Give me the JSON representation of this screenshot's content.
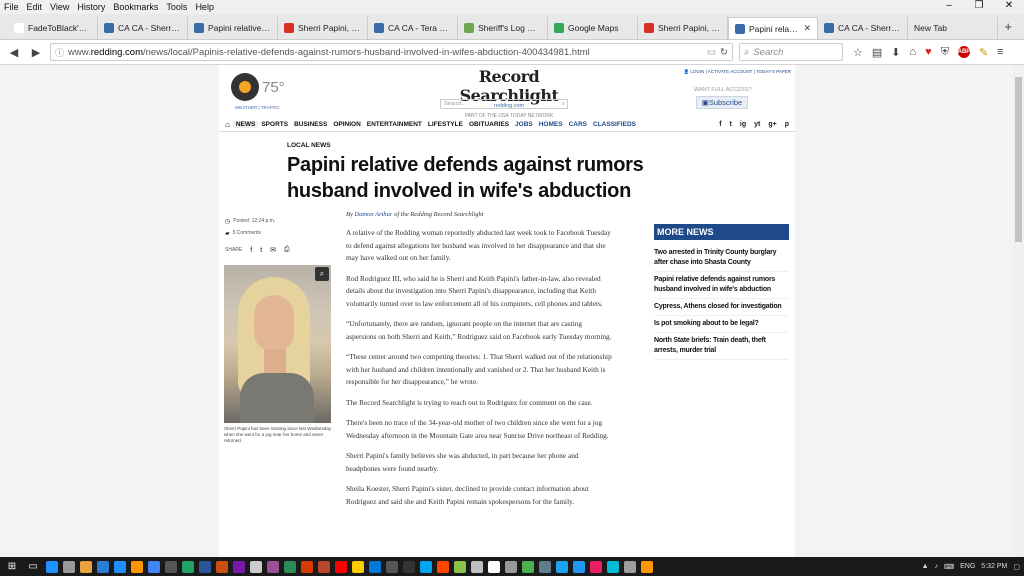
{
  "menu": [
    "File",
    "Edit",
    "View",
    "History",
    "Bookmarks",
    "Tools",
    "Help"
  ],
  "window_controls": [
    "–",
    "❐",
    "✕"
  ],
  "tabs": [
    {
      "label": "FadeToBlack's podc...",
      "color": "#ffffff"
    },
    {
      "label": "CA CA - Sherri ...",
      "color": "#3a6ba8"
    },
    {
      "label": "Papini relative d...",
      "color": "#3a6ba8"
    },
    {
      "label": "Sherri Papini, 3...",
      "color": "#d93025"
    },
    {
      "label": "CA CA - Tera S...",
      "color": "#3a6ba8"
    },
    {
      "label": "Sheriff's Log No...",
      "color": "#6ba84f"
    },
    {
      "label": "Google Maps",
      "color": "#34a853"
    },
    {
      "label": "Sherri Papini, 3...",
      "color": "#d93025"
    },
    {
      "label": "Papini relati...",
      "color": "#3a6ba8",
      "active": true
    },
    {
      "label": "CA CA - Sherri ...",
      "color": "#3a6ba8"
    },
    {
      "label": "New Tab",
      "color": ""
    }
  ],
  "address": {
    "prefix": "www.",
    "domain": "redding.com",
    "path": "/news/local/Papinis-relative-defends-against-rumors-husband-involved-in-wifes-abduction-400434981.html"
  },
  "search_placeholder": "Search",
  "site": {
    "temperature": "75°",
    "weather_links": "WEATHER | TRAFFIC",
    "logo": "Record Searchlight",
    "logo_domain": "redding.com",
    "network": "PART OF THE USA TODAY NETWORK",
    "search_placeholder": "Search...",
    "account_links": "LOGIN | ACTIVATE ACCOUNT | TODAY'S PAPER",
    "want_access": "WANT FULL ACCESS?",
    "subscribe": "Subscribe",
    "nav": [
      {
        "label": "NEWS",
        "active": true
      },
      {
        "label": "SPORTS"
      },
      {
        "label": "BUSINESS"
      },
      {
        "label": "OPINION"
      },
      {
        "label": "ENTERTAINMENT"
      },
      {
        "label": "LIFESTYLE"
      },
      {
        "label": "OBITUARIES"
      },
      {
        "label": "JOBS",
        "blue": true
      },
      {
        "label": "HOMES",
        "blue": true
      },
      {
        "label": "CARS",
        "blue": true
      },
      {
        "label": "CLASSIFIEDS",
        "blue": true
      }
    ],
    "social": [
      "f",
      "t",
      "ig",
      "yt",
      "g+",
      "p"
    ]
  },
  "article": {
    "kicker": "LOCAL NEWS",
    "headline": "Papini relative defends against rumors husband involved in wife's abduction",
    "posted": "Posted: 12:24 p.m.",
    "comments": "5 Comments",
    "share_label": "SHARE",
    "byline_prefix": "By",
    "author": "Damon Arthur",
    "byline_suffix": "of the Redding Record Searchlight",
    "photo_caption": "Sherri Papini has been missing since last Wednesday when she went for a jog near her home and never returned.",
    "paragraphs": [
      "A relative of the Redding woman reportedly abducted last week took to Facebook Tuesday to defend against allegations her husband was involved in her disappearance and that she may have walked out on her family.",
      "Rod Rodriguez III, who said he is Sherri and Keith Papini's father-in-law, also revealed details about the investigation into Sherri Papini's disappearance, including that Keith voluntarily turned over to law enforcement all of his computers, cell phones and tablets.",
      "“Unfortunately, there are random, ignorant people on the internet that are casting aspersions on both Sherri and Keith,” Rodriguez said on Facebook early Tuesday morning.",
      "“These center around two competing theories: 1. That Sherri walked out of the relationship with her husband and children intentionally and vanished or 2. That her husband Keith is responsible for her disappearance,” he wrote.",
      "The Record Searchlight is trying to reach out to Rodriguez for comment on the case.",
      "There's been no trace of the 34-year-old mother of two children since she went for a jog Wednesday afternoon in the Mountain Gate area near Sunrise Drive northeast of Redding.",
      "Sherri Papini's family believes she was abducted, in part because her phone and headphones were found nearby.",
      "Sheila Koester, Sherri Papini's sister, declined to provide contact information about Rodriguez and said she and Keith Papini remain spokespersons for the family."
    ]
  },
  "more_news": {
    "title": "MORE NEWS",
    "items": [
      "Two arrested in Trinity County burglary after chase into Shasta County",
      "Papini relative defends against rumors husband involved in wife's abduction",
      "Cypress, Athens closed for investigation",
      "Is pot smoking about to be legal?",
      "North State briefs: Train death, theft arrests, murder trial"
    ]
  },
  "taskbar": {
    "app_colors": [
      "#1e90ff",
      "#999999",
      "#e8a33d",
      "#2b7cd3",
      "#1e90ff",
      "#ff9500",
      "#4285f4",
      "#555555",
      "#21a366",
      "#2b579a",
      "#ca5010",
      "#7719aa",
      "#cccccc",
      "#9b4f96",
      "#2e8b57",
      "#d83b01",
      "#b7472a",
      "#ff0000",
      "#ffcc00",
      "#0078d7",
      "#555555",
      "#333333",
      "#00a4ef",
      "#ff4500",
      "#8bc34a",
      "#c0c0c0",
      "#ffffff",
      "#999999",
      "#4caf50",
      "#607d8b",
      "#1da1f2",
      "#2196f3",
      "#e91e63",
      "#00bcd4",
      "#9e9e9e",
      "#ff9800"
    ],
    "lang": "ENG",
    "time": "5:32 PM"
  }
}
